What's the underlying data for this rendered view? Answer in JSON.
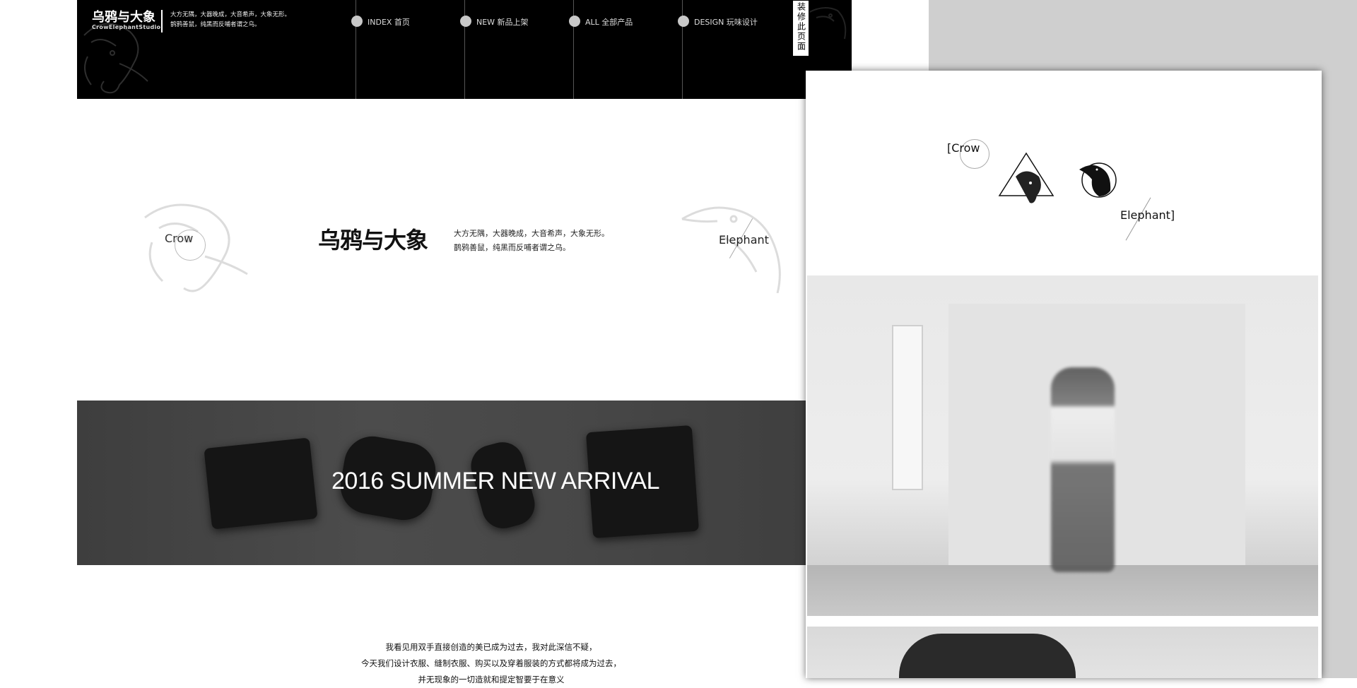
{
  "header": {
    "brand_title": "乌鸦与大象",
    "brand_sub": "CrowElephantStudio",
    "slogan_line1": "大方无隅，大器晚成，大音希声，大象无形。",
    "slogan_line2": "鹊鸦善鼠，纯黑而反哺者谓之乌。",
    "nav": [
      {
        "label": "INDEX 首页"
      },
      {
        "label": "NEW 新品上架"
      },
      {
        "label": "ALL 全部产品"
      },
      {
        "label": "DESIGN 玩味设计"
      }
    ],
    "vertical_tab": "装修此页面"
  },
  "brand_mid": {
    "crow_label": "Crow",
    "title": "乌鸦与大象",
    "slogan_line1": "大方无隅，大器晚成，大音希声，大象无形。",
    "slogan_line2": "鹊鸦善鼠，纯黑而反哺者谓之乌。",
    "elephant_label": "Elephant"
  },
  "banner": {
    "headline": "2016 SUMMER NEW ARRIVAL"
  },
  "poem": {
    "line1": "我看见用双手直接创造的美已成为过去，我对此深信不疑，",
    "line2": "今天我们设计衣服、缝制衣服、购买以及穿着服装的方式都将成为过去，",
    "line3": "并无现象的一切造就和提定智要于在意义"
  },
  "panel": {
    "crow_label": "[Crow",
    "elephant_label": "Elephant]"
  },
  "colors": {
    "header_bg": "#000000",
    "side_bg": "#cfcfcf",
    "nav_dot": "#c8c8c8"
  }
}
